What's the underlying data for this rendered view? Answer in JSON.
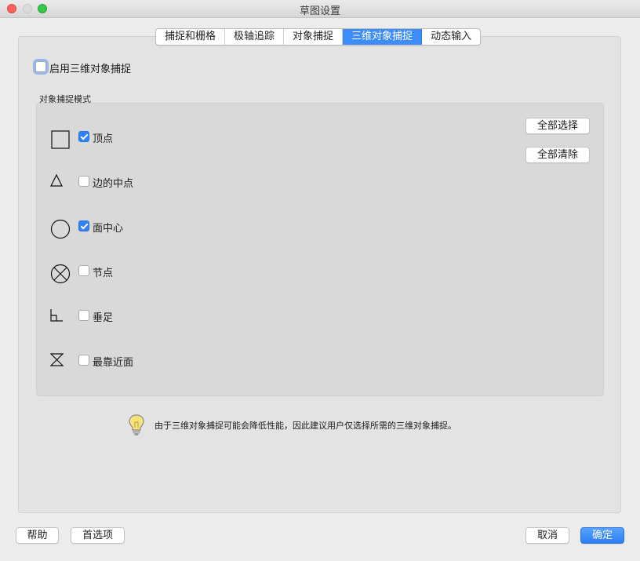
{
  "window": {
    "title": "草图设置"
  },
  "tabs": [
    {
      "label": "捕捉和栅格",
      "active": false
    },
    {
      "label": "极轴追踪",
      "active": false
    },
    {
      "label": "对象捕捉",
      "active": false
    },
    {
      "label": "三维对象捕捉",
      "active": true
    },
    {
      "label": "动态输入",
      "active": false
    }
  ],
  "enable": {
    "label": "启用三维对象捕捉",
    "checked": false
  },
  "group": {
    "title": "对象捕捉模式",
    "modes": [
      {
        "label": "顶点",
        "checked": true,
        "icon": "square-vertex-icon"
      },
      {
        "label": "边的中点",
        "checked": false,
        "icon": "triangle-midpoint-icon"
      },
      {
        "label": "面中心",
        "checked": true,
        "icon": "circle-center-icon"
      },
      {
        "label": "节点",
        "checked": false,
        "icon": "circle-x-node-icon"
      },
      {
        "label": "垂足",
        "checked": false,
        "icon": "perpendicular-icon"
      },
      {
        "label": "最靠近面",
        "checked": false,
        "icon": "hourglass-nearest-icon"
      }
    ],
    "select_all": "全部选择",
    "clear_all": "全部清除"
  },
  "note": "由于三维对象捕捉可能会降低性能，因此建议用户仅选择所需的三维对象捕捉。",
  "footer": {
    "help": "帮助",
    "options": "首选项",
    "cancel": "取消",
    "ok": "确定"
  },
  "colors": {
    "accent": "#2f81f7",
    "close": "#fc615d",
    "maximize": "#34c84a"
  }
}
